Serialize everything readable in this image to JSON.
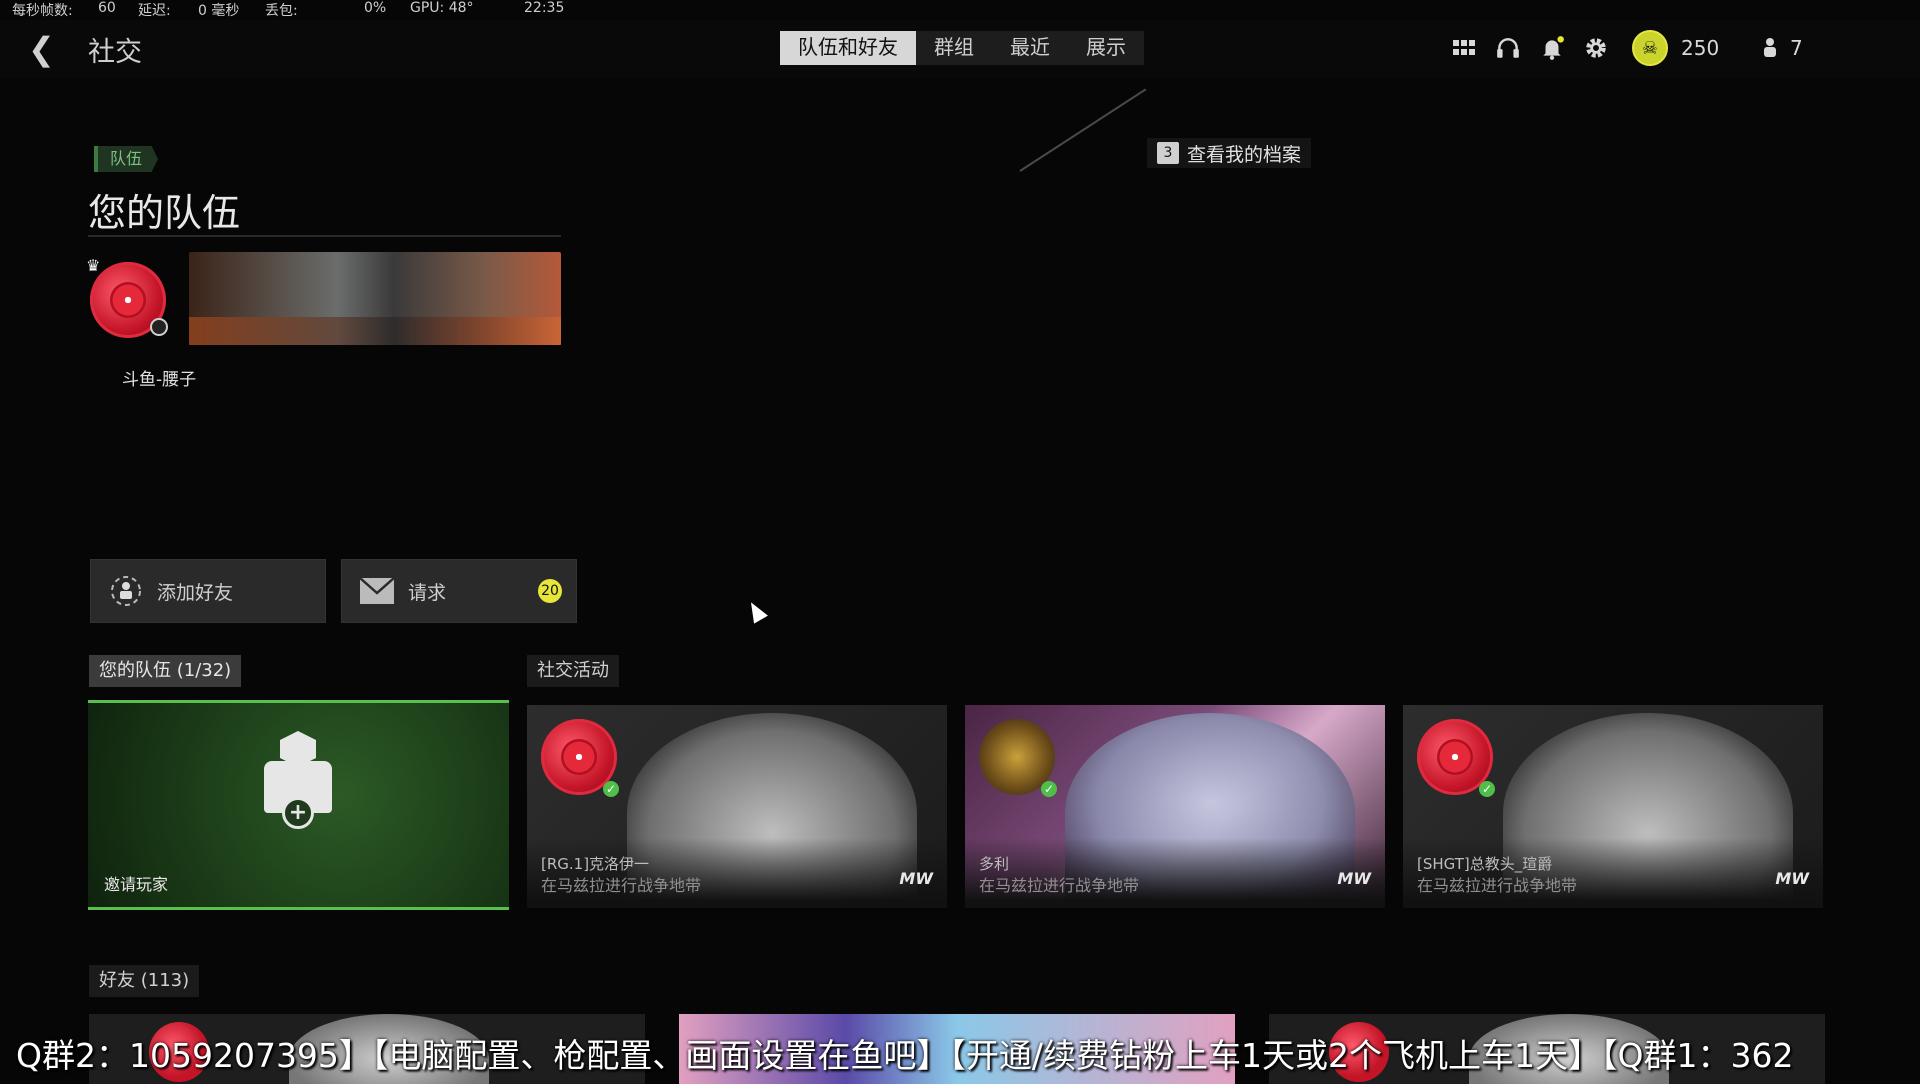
{
  "stats": {
    "fps_label": "每秒帧数:",
    "fps_value": "60",
    "latency_label": "延迟:",
    "latency_value": "0 毫秒",
    "loss_label": "丢包:",
    "loss_value": "0%",
    "gpu": "GPU: 48°",
    "time": "22:35"
  },
  "header": {
    "title": "社交",
    "tabs": [
      "队伍和好友",
      "群组",
      "最近",
      "展示"
    ],
    "active_tab": 0,
    "currency": "250",
    "players_count": "7"
  },
  "team": {
    "tag": "队伍",
    "heading": "您的队伍",
    "player_name": "斗鱼-腰子",
    "callout_key": "3",
    "callout_text": "查看我的档案"
  },
  "buttons": {
    "add_friend": "添加好友",
    "requests": "请求",
    "requests_badge": "20"
  },
  "sections": {
    "your_team": "您的队伍 (1/32)",
    "social_activity": "社交活动",
    "friends": "好友 (113)"
  },
  "invite": {
    "label": "邀请玩家"
  },
  "activity": [
    {
      "name": "[RG.1]克洛伊一",
      "status": "在马兹拉进行战争地带",
      "game": "MW"
    },
    {
      "name": "多利",
      "status": "在马兹拉进行战争地带",
      "game": "MW"
    },
    {
      "name": "[SHGT]总教头_瑄爵",
      "status": "在马兹拉进行战争地带",
      "game": "MW"
    }
  ],
  "ticker": "Q群2：1059207395】【电脑配置、枪配置、画面设置在鱼吧】【开通/续费钻粉上车1天或2个飞机上车1天】【Q群1：362",
  "colors": {
    "accent_green": "#5bbf4e",
    "badge_yellow": "#e6e63a",
    "coin_yellow": "#cbd42c"
  }
}
